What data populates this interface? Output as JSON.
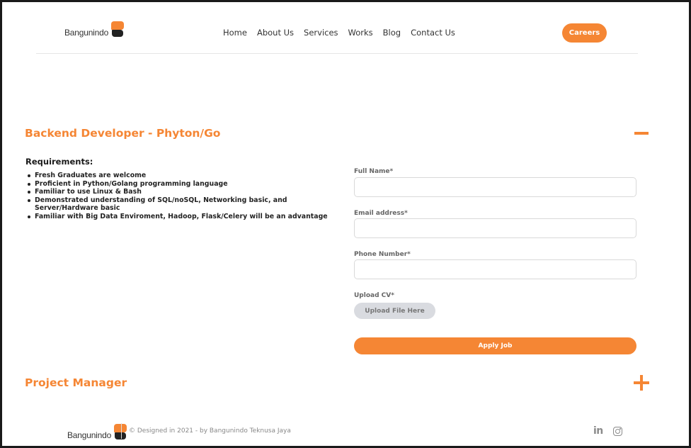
{
  "brand": {
    "name": "Bangunindo",
    "accent_color": "#f58634",
    "dark_color": "#222222"
  },
  "nav": {
    "items": [
      "Home",
      "About Us",
      "Services",
      "Works",
      "Blog",
      "Contact Us"
    ],
    "careers_label": "Careers"
  },
  "jobs": [
    {
      "title": "Backend Developer - Phyton/Go",
      "expanded": true,
      "toggle_icon": "minus-icon",
      "requirements_heading": "Requirements:",
      "requirements": [
        "Fresh Graduates are welcome",
        "Proficient in Python/Golang programming language",
        "Familiar to use Linux & Bash",
        "Demonstrated understanding of SQL/noSQL, Networking basic, and Server/Hardware basic",
        "Familiar with Big Data Enviroment, Hadoop, Flask/Celery will be an advantage"
      ]
    },
    {
      "title": "Project Manager",
      "expanded": false,
      "toggle_icon": "plus-icon"
    }
  ],
  "form": {
    "full_name_label": "Full Name*",
    "full_name_value": "",
    "email_label": "Email address*",
    "email_value": "",
    "phone_label": "Phone Number*",
    "phone_value": "",
    "cv_label": "Upload CV*",
    "upload_button": "Upload File Here",
    "apply_button": "Apply Job"
  },
  "footer": {
    "copyright": "© Designed in 2021 - by Bangunindo Teknusa Jaya",
    "social": {
      "linkedin_text": "in",
      "icons": [
        "linkedin-icon",
        "instagram-icon"
      ]
    }
  }
}
